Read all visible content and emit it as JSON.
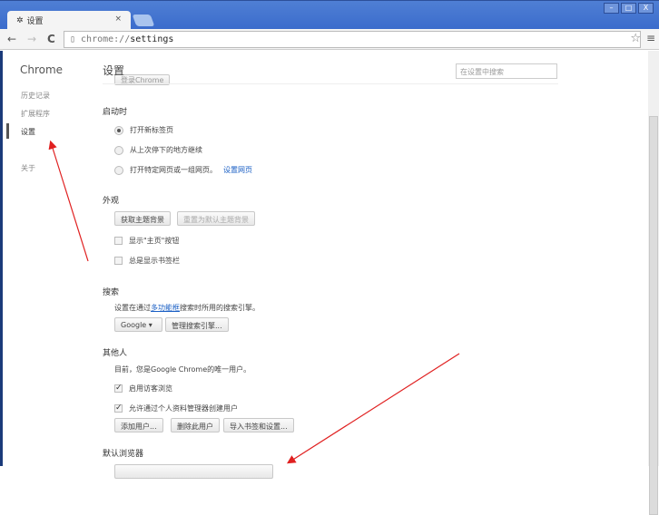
{
  "window": {
    "tab_title": "设置",
    "tab_close": "×",
    "minimize": "–",
    "maximize": "□",
    "close": "X"
  },
  "toolbar": {
    "back": "←",
    "forward": "→",
    "reload": "C",
    "url_prefix": "chrome://",
    "url_path": "settings",
    "star": "☆",
    "menu": "≡"
  },
  "sidebar": {
    "brand": "Chrome",
    "items": [
      {
        "label": "历史记录"
      },
      {
        "label": "扩展程序"
      },
      {
        "label": "设置",
        "selected": true
      },
      {
        "label": "关于"
      }
    ]
  },
  "main": {
    "title": "设置",
    "search_placeholder": "在设置中搜索",
    "signin_button": "登录Chrome",
    "startup": {
      "heading": "启动时",
      "options": [
        {
          "label": "打开新标签页",
          "checked": true
        },
        {
          "label": "从上次停下的地方继续",
          "checked": false
        },
        {
          "label": "打开特定网页或一组网页。",
          "checked": false,
          "link": "设置网页"
        }
      ]
    },
    "appearance": {
      "heading": "外观",
      "get_themes": "获取主题背景",
      "reset_theme": "重置为默认主题背景",
      "show_home": "显示\"主页\"按钮",
      "show_bookmarks": "总是显示书签栏"
    },
    "search": {
      "heading": "搜索",
      "desc_pre": "设置在通过",
      "desc_link": "多功能框",
      "desc_post": "搜索时所用的搜索引擎。",
      "engine": "Google",
      "manage": "管理搜索引擎..."
    },
    "people": {
      "heading": "其他人",
      "desc": "目前，您是Google Chrome的唯一用户。",
      "guest": "启用访客浏览",
      "allow_create": "允许通过个人资料管理器创建用户",
      "add_user": "添加用户...",
      "delete_user": "删除此用户",
      "import": "导入书签和设置..."
    },
    "default_browser": {
      "heading": "默认浏览器"
    }
  },
  "annotation_color": "#e02020"
}
